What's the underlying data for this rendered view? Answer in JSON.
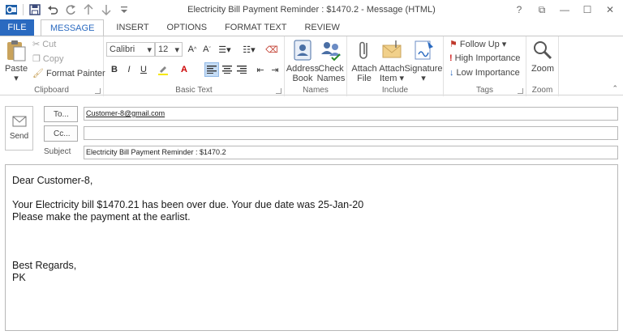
{
  "window": {
    "title": "Electricity Bill Payment Reminder : $1470.2 - Message (HTML)",
    "help": "?",
    "restore": "⧉",
    "minimize": "—",
    "maximize": "☐",
    "close": "✕"
  },
  "tabs": [
    {
      "label": "FILE"
    },
    {
      "label": "MESSAGE"
    },
    {
      "label": "INSERT"
    },
    {
      "label": "OPTIONS"
    },
    {
      "label": "FORMAT TEXT"
    },
    {
      "label": "REVIEW"
    }
  ],
  "ribbon": {
    "clipboard": {
      "label": "Clipboard",
      "paste": "Paste",
      "cut": "Cut",
      "copy": "Copy",
      "format_painter": "Format Painter"
    },
    "basic_text": {
      "label": "Basic Text",
      "font": "Calibri",
      "size": "12",
      "bold": "B",
      "italic": "I",
      "underline": "U"
    },
    "names": {
      "label": "Names",
      "address_book_1": "Address",
      "address_book_2": "Book",
      "check_names_1": "Check",
      "check_names_2": "Names"
    },
    "include": {
      "label": "Include",
      "attach_file_1": "Attach",
      "attach_file_2": "File",
      "attach_item_1": "Attach",
      "attach_item_2": "Item",
      "signature": "Signature"
    },
    "tags": {
      "label": "Tags",
      "follow_up": "Follow Up",
      "high_importance": "High Importance",
      "low_importance": "Low Importance"
    },
    "zoom": {
      "label": "Zoom",
      "zoom": "Zoom"
    }
  },
  "header": {
    "send_label": "Send",
    "to_label": "To...",
    "to_value": "Customer-8@gmail.com",
    "cc_label": "Cc...",
    "cc_value": "",
    "subject_label": "Subject",
    "subject_value": "Electricity Bill Payment Reminder : $1470.2"
  },
  "message": {
    "greeting": "Dear Customer-8,",
    "line1": "Your Electricity bill $1470.21 has been over due. Your due date was 25-Jan-20",
    "line2": "Please make the payment at the earlist.",
    "closing": "Best Regards,",
    "signature": "PK"
  },
  "colors": {
    "accent": "#2a6ac0",
    "follow_up_flag": "#c0392b",
    "high_importance": "#d02020",
    "low_importance": "#2a6ac0"
  }
}
